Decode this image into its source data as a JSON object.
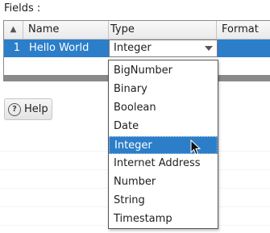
{
  "fields_label": "Fields :",
  "table": {
    "headers": {
      "sort": "▲",
      "name": "Name",
      "type": "Type",
      "format": "Format"
    },
    "row": {
      "number": "1",
      "name": "Hello World",
      "type": "Integer"
    }
  },
  "help_button": {
    "label": "Help",
    "icon_glyph": "?"
  },
  "dropdown": {
    "options": [
      "BigNumber",
      "Binary",
      "Boolean",
      "Date",
      "Integer",
      "Internet Address",
      "Number",
      "String",
      "Timestamp"
    ],
    "selected": "Integer"
  },
  "colors": {
    "selection": "#2c7ec9"
  }
}
